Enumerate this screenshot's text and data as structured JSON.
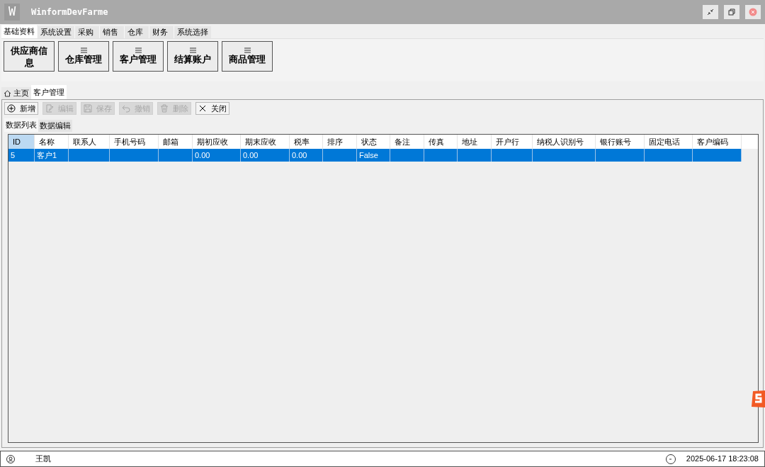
{
  "window": {
    "logo": "W",
    "title": "WinformDevFarme"
  },
  "menu_tabs": [
    {
      "label": "基础资料",
      "selected": true
    },
    {
      "label": "系统设置",
      "selected": false
    },
    {
      "label": "采购",
      "selected": false
    },
    {
      "label": "销售",
      "selected": false
    },
    {
      "label": "仓库",
      "selected": false
    },
    {
      "label": "财务",
      "selected": false
    },
    {
      "label": "系统选择",
      "selected": false
    }
  ],
  "ribbon_buttons": [
    "供应商信息",
    "仓库管理",
    "客户管理",
    "结算账户",
    "商品管理"
  ],
  "doc_tabs": [
    {
      "label": "主页",
      "kind": "home",
      "selected": false
    },
    {
      "label": "客户管理",
      "kind": "page",
      "selected": true
    }
  ],
  "toolbar": [
    {
      "label": "新增",
      "kind": "add",
      "disabled": false
    },
    {
      "label": "编辑",
      "kind": "edit",
      "disabled": true
    },
    {
      "label": "保存",
      "kind": "save",
      "disabled": true
    },
    {
      "label": "撤销",
      "kind": "undo",
      "disabled": true
    },
    {
      "label": "删除",
      "kind": "delete",
      "disabled": true
    },
    {
      "label": "关闭",
      "kind": "close",
      "disabled": false
    }
  ],
  "view_tabs": [
    {
      "label": "数据列表",
      "selected": true
    },
    {
      "label": "数据编辑",
      "selected": false
    }
  ],
  "table": {
    "columns": [
      "ID",
      "名称",
      "联系人",
      "手机号码",
      "邮箱",
      "期初应收",
      "期末应收",
      "税率",
      "排序",
      "状态",
      "备注",
      "传真",
      "地址",
      "开户行",
      "纳税人识别号",
      "银行账号",
      "固定电话",
      "客户编码"
    ],
    "rows": [
      {
        "selected": true,
        "cells": [
          "5",
          "客户1",
          "",
          "",
          "",
          "0.00",
          "0.00",
          "0.00",
          "",
          "False",
          "",
          "",
          "",
          "",
          "",
          "",
          "",
          ""
        ]
      }
    ]
  },
  "status_bar": {
    "user": "王凯",
    "datetime": "2025-06-17 18:23:08"
  }
}
